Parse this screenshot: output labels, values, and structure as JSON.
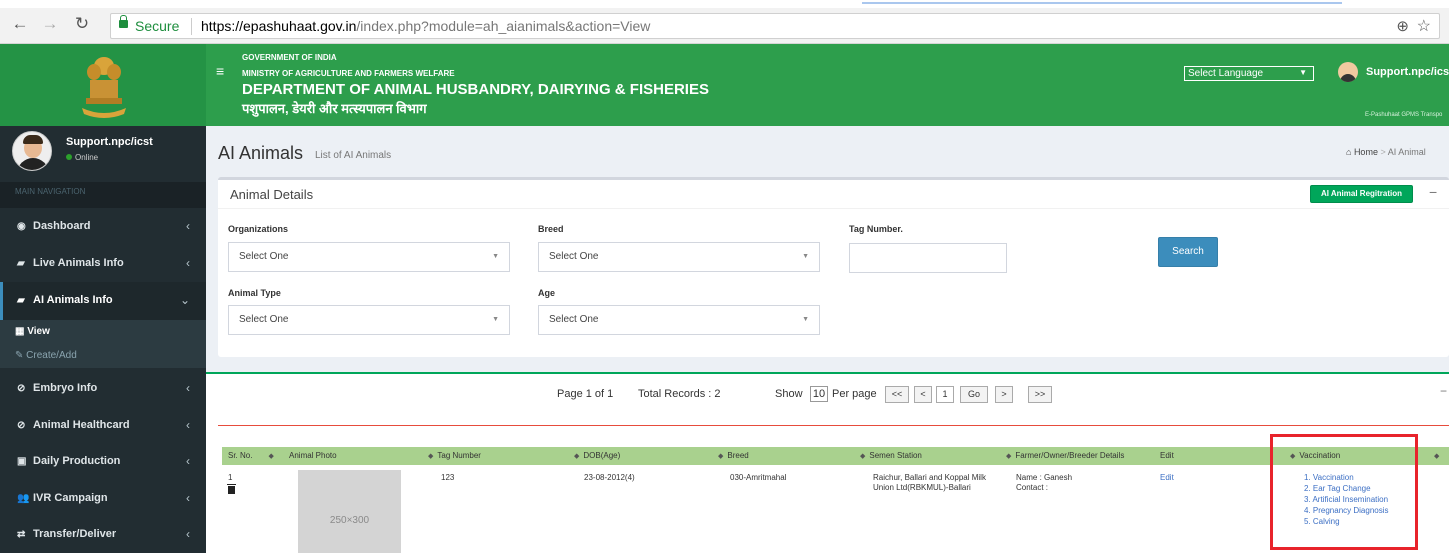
{
  "browser": {
    "secure_label": "Secure",
    "url_host": "https://epashuhaat.gov.in",
    "url_path": "/index.php?module=ah_aianimals&action=View"
  },
  "header": {
    "line1": "GOVERNMENT OF INDIA",
    "line2": "MINISTRY OF AGRICULTURE AND FARMERS WELFARE",
    "line3": "DEPARTMENT OF ANIMAL HUSBANDRY, DAIRYING & FISHERIES",
    "line4": "पशुपालन, डेयरी और मत्स्यपालन विभाग",
    "language_select": "Select Language",
    "user": "Support.npc/icst",
    "tagline": "E-Pashuhaat GPMS Transpo"
  },
  "sidebar": {
    "user": "Support.npc/icst",
    "status": "Online",
    "section": "MAIN NAVIGATION",
    "items": [
      {
        "label": "Dashboard",
        "icon": "dashboard-icon"
      },
      {
        "label": "Live Animals Info",
        "icon": "cow-icon"
      },
      {
        "label": "AI Animals Info",
        "icon": "cow-icon"
      },
      {
        "label": "Embryo Info",
        "icon": "circle-icon"
      },
      {
        "label": "Animal Healthcard",
        "icon": "circle-icon"
      },
      {
        "label": "Daily Production",
        "icon": "chart-icon"
      },
      {
        "label": "IVR Campaign",
        "icon": "people-icon"
      },
      {
        "label": "Transfer/Deliver",
        "icon": "shuffle-icon"
      }
    ],
    "submenu": [
      {
        "label": "View"
      },
      {
        "label": "Create/Add"
      }
    ]
  },
  "page": {
    "title": "AI Animals",
    "subtitle": "List of AI Animals",
    "breadcrumb_home": "Home",
    "breadcrumb_current": "AI Animal"
  },
  "filters": {
    "box_title": "Animal Details",
    "register_button": "AI Animal Regitration",
    "organizations_label": "Organizations",
    "organizations_value": "Select One",
    "breed_label": "Breed",
    "breed_value": "Select One",
    "tag_label": "Tag Number.",
    "animal_type_label": "Animal Type",
    "animal_type_value": "Select One",
    "age_label": "Age",
    "age_value": "Select One",
    "search_button": "Search"
  },
  "pager": {
    "page_info": "Page 1 of 1",
    "total": "Total Records : 2",
    "show_label": "Show",
    "per_page_value": "10",
    "per_page_label": "Per page",
    "first": "<<",
    "prev": "<",
    "page_value": "1",
    "go": "Go",
    "next": ">",
    "last": ">>"
  },
  "table": {
    "headers": [
      "Sr. No.",
      "Animal Photo",
      "Tag Number",
      "DOB(Age)",
      "Breed",
      "Semen Station",
      "Farmer/Owner/Breeder Details",
      "Edit",
      "Vaccination"
    ],
    "row": {
      "sr": "1",
      "photo_placeholder": "250×300",
      "tag": "123",
      "dob": "23-08-2012(4)",
      "breed": "030-Amritmahal",
      "station_line1": "Raichur, Ballari and Koppal Milk",
      "station_line2": "Union Ltd(RBKMUL)-Ballari",
      "farmer_name": "Name : Ganesh",
      "farmer_contact": "Contact :",
      "edit": "Edit",
      "actions": [
        "1. Vaccination",
        "2. Ear Tag Change",
        "3. Artificial Insemination",
        "4. Pregnancy Diagnosis",
        "5. Calving"
      ]
    }
  },
  "colors": {
    "header_green": "#2d9e4c",
    "sidebar_dark": "#222d32",
    "table_head": "#a9d18e",
    "highlight_red": "#e8232b"
  }
}
